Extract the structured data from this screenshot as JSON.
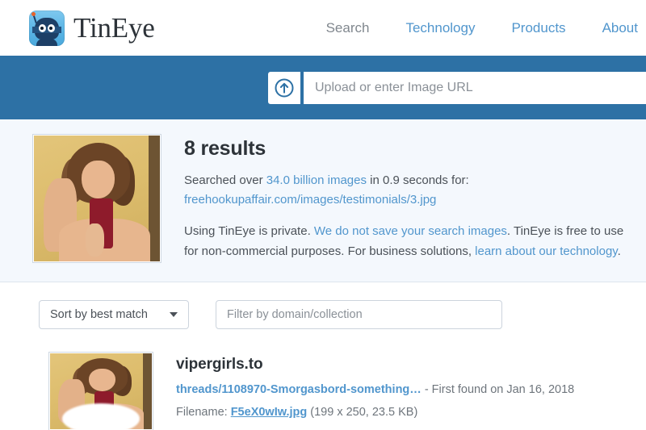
{
  "header": {
    "logo_icon": "tineye-ninja-logo-icon",
    "brand_name": "TinEye",
    "nav": [
      {
        "label": "Search",
        "current": true
      },
      {
        "label": "Technology",
        "current": false
      },
      {
        "label": "Products",
        "current": false
      },
      {
        "label": "About",
        "current": false
      }
    ]
  },
  "search_bar": {
    "upload_icon": "upload-circle-arrow-icon",
    "placeholder": "Upload or enter Image URL",
    "value": "",
    "banner_color": "#2d71a5"
  },
  "summary": {
    "results_count": "8 results",
    "searched_prefix": "Searched over ",
    "index_size": "34.0 billion images",
    "searched_suffix": " in 0.9 seconds for:",
    "query_url": "freehookupaffair.com/images/testimonials/3.jpg",
    "privacy_part1": "Using TinEye is private. ",
    "privacy_link1": "We do not save your search images",
    "privacy_part2": ". TinEye is free to use for non-commercial purposes. For business solutions, ",
    "privacy_link2": "learn about our technology",
    "privacy_part3": ".",
    "query_thumbnail_alt": "query-image-selfie"
  },
  "filters": {
    "sort_label": "Sort by best match",
    "sort_caret_icon": "chevron-down-icon",
    "domain_placeholder": "Filter by domain/collection",
    "domain_value": ""
  },
  "results": [
    {
      "domain": "vipergirls.to",
      "path": "threads/1108970-Smorgasbord-something…",
      "found_text": " - First found on Jan 16, 2018",
      "filename_label": "Filename: ",
      "filename": "F5eX0wIw.jpg",
      "file_meta": " (199 x 250, 23.5 KB)",
      "thumbnail_alt": "result-image-selfie-censored"
    }
  ],
  "colors": {
    "accent_blue": "#5196cd",
    "banner_blue": "#2d71a5",
    "summary_bg": "#f4f8fd",
    "text_dark": "#2d3339",
    "text_muted": "#6e757c"
  }
}
